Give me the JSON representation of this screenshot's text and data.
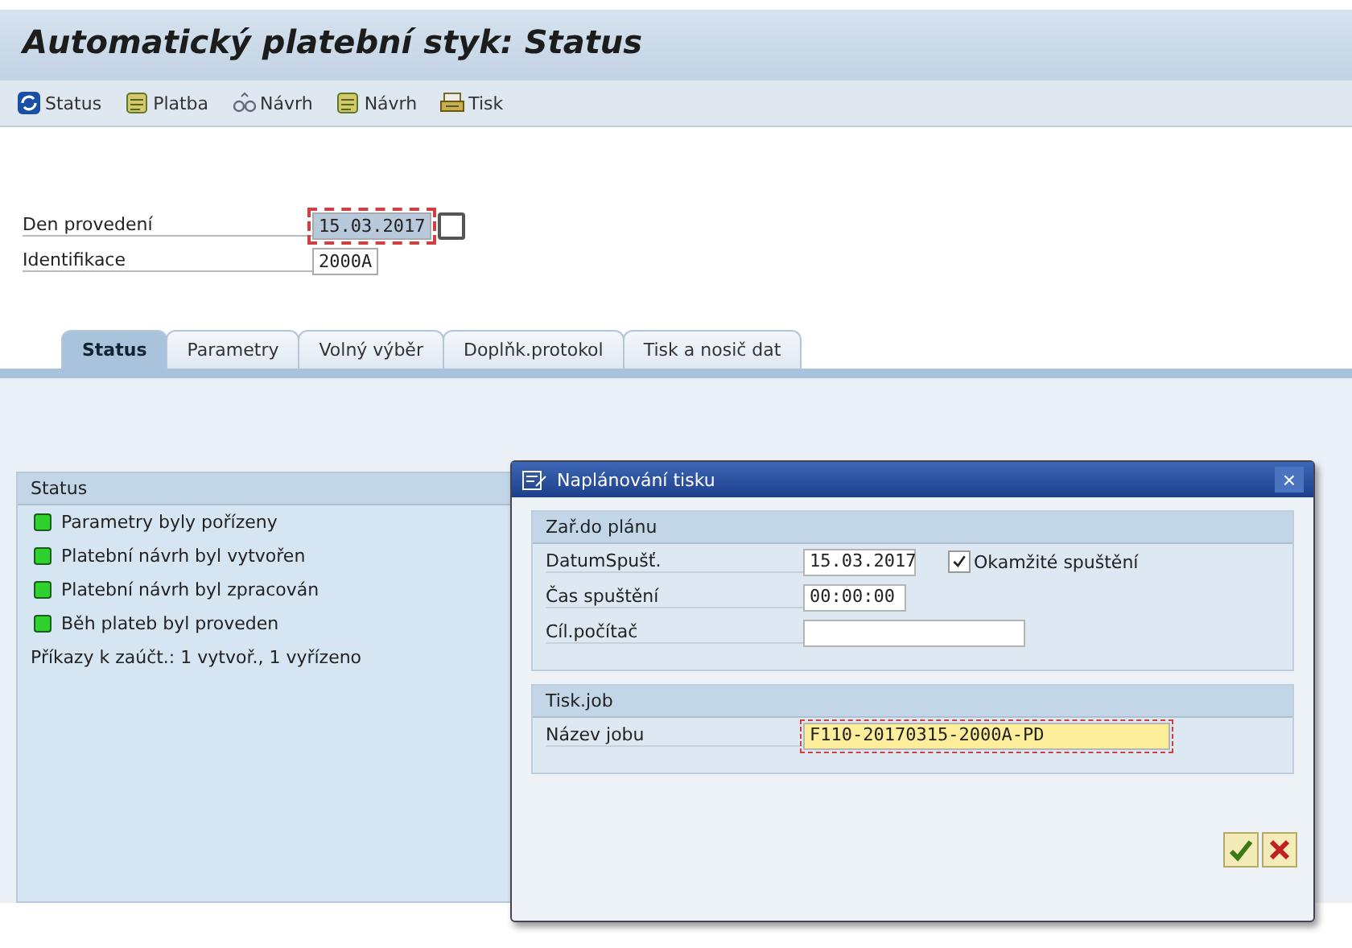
{
  "window": {
    "title": "Automatický platební styk: Status"
  },
  "toolbar": [
    {
      "label": "Status",
      "kind": "refresh"
    },
    {
      "label": "Platba",
      "kind": "scroll"
    },
    {
      "label": "Návrh",
      "kind": "glasses"
    },
    {
      "label": "Návrh",
      "kind": "scroll"
    },
    {
      "label": "Tisk",
      "kind": "print"
    }
  ],
  "fields": [
    {
      "label": "Den provedení",
      "value": "15.03.2017",
      "focused": true,
      "picker": true
    },
    {
      "label": "Identifikace",
      "value": "2000A",
      "focused": false,
      "picker": false
    }
  ],
  "tabs": [
    {
      "label": "Status",
      "selected": true
    },
    {
      "label": "Parametry",
      "selected": false
    },
    {
      "label": "Volný výběr",
      "selected": false
    },
    {
      "label": "Doplňk.protokol",
      "selected": false
    },
    {
      "label": "Tisk a nosič dat",
      "selected": false
    }
  ],
  "status_group": {
    "title": "Status",
    "lines": [
      {
        "text": "Parametry byly pořízeny",
        "color": "#2fd12f"
      },
      {
        "text": "Platební návrh byl vytvořen",
        "color": "#2fd12f"
      },
      {
        "text": "Platební návrh byl zpracován",
        "color": "#2fd12f"
      },
      {
        "text": "Běh plateb byl proveden",
        "color": "#2fd12f"
      }
    ],
    "summary": "Příkazy k zaúčt.: 1 vytvoř., 1 vyřízeno"
  },
  "dialog": {
    "title": "Naplánování tisku",
    "close": "×",
    "groups": [
      {
        "title": "Zař.do plánu",
        "rows": [
          {
            "label": "DatumSpušť.",
            "value": "15.03.2017",
            "focused": false,
            "checkbox": {
              "label": "Okamžité spuštění",
              "checked": true
            }
          },
          {
            "label": "Čas spuštění",
            "value": "00:00:00",
            "focused": false
          },
          {
            "label": "Cíl.počítač",
            "value": "",
            "focused": false
          }
        ]
      },
      {
        "title": "Tisk.job",
        "rows": [
          {
            "label": "Název jobu",
            "value": "F110-20170315-2000A-PD",
            "focused": true
          }
        ]
      }
    ]
  }
}
